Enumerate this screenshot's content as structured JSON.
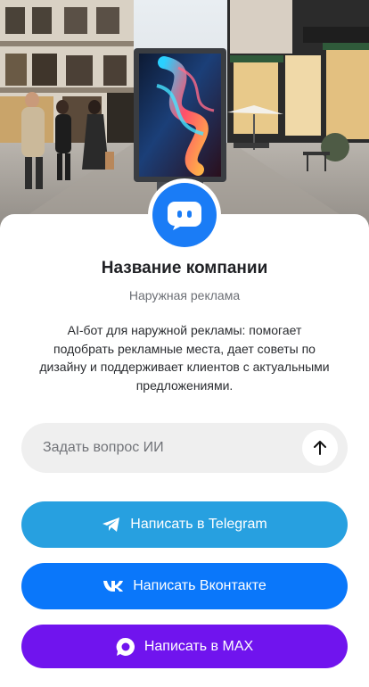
{
  "hero": {
    "image": "street-advertising-billboard-illustration"
  },
  "company": {
    "avatar_icon": "chat-bot-icon",
    "name": "Название компании",
    "category": "Наружная реклама",
    "description": "AI-бот для наружной рекламы: помогает подобрать рекламные места, дает советы по дизайну и поддерживает клиентов с актуальными предложениями."
  },
  "ask": {
    "placeholder": "Задать вопрос ИИ",
    "send_icon": "arrow-up-icon"
  },
  "buttons": {
    "telegram": {
      "label": "Написать в Telegram",
      "icon": "telegram-icon",
      "color": "#27a0e0"
    },
    "vk": {
      "label": "Написать Вконтакте",
      "icon": "vk-icon",
      "color": "#0a77fa"
    },
    "max": {
      "label": "Написать в MAX",
      "icon": "max-icon",
      "color": "#7014ee"
    }
  },
  "colors": {
    "accent": "#1a7cf6",
    "background": "#ffffff"
  }
}
